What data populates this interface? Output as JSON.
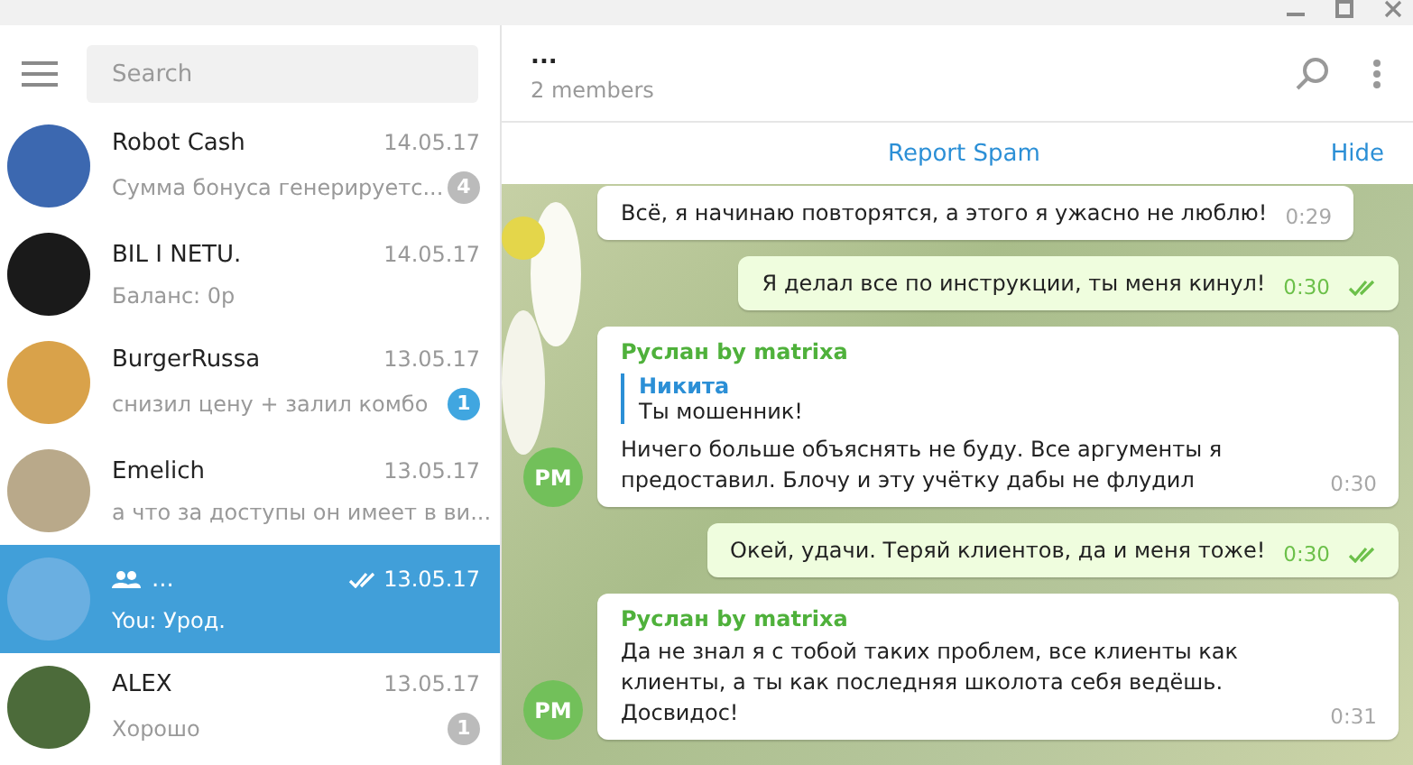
{
  "sidebar": {
    "search": {
      "placeholder": "Search"
    },
    "chats": [
      {
        "kind": "user",
        "name": "Robot Cash",
        "date": "14.05.17",
        "preview": "Сумма бонуса генерируетс...",
        "unread": "4",
        "muted": true,
        "selected": false,
        "read": false
      },
      {
        "kind": "user",
        "name": "BIL I NETU.",
        "date": "14.05.17",
        "preview": "Баланс: 0р",
        "selected": false,
        "read": false
      },
      {
        "kind": "user",
        "name": "BurgerRussa",
        "date": "13.05.17",
        "preview": "снизил цену + залил комбо",
        "unread": "1",
        "muted": false,
        "selected": false,
        "read": false
      },
      {
        "kind": "user",
        "name": "Emelich",
        "date": "13.05.17",
        "preview": "а что за доступы он имеет в ви...",
        "selected": false,
        "read": false
      },
      {
        "kind": "group",
        "name": "...",
        "date": "13.05.17",
        "preview": "You: Урод.",
        "selected": true,
        "read": true
      },
      {
        "kind": "user",
        "name": "ALEX",
        "date": "13.05.17",
        "preview": "Хорошо",
        "unread": "1",
        "muted": true,
        "selected": false,
        "read": false
      }
    ]
  },
  "chat": {
    "title": "...",
    "subtitle": "2 members",
    "report_spam": "Report Spam",
    "hide": "Hide",
    "messages": [
      {
        "kind": "in",
        "text": "Всё, я начинаю повторятся, а этого я ужасно не люблю!",
        "time": "0:29"
      },
      {
        "kind": "out",
        "text": "Я делал все по инструкции,  ты меня кинул!",
        "time": "0:30",
        "read": true
      },
      {
        "kind": "in",
        "author": "Руслан by matrixa",
        "reply": {
          "author": "Никита",
          "text": "Ты мошенник!"
        },
        "text": "Ничего больше объяснять не буду. Все аргументы я предоставил. Блочу и эту учётку дабы не флудил",
        "time": "0:30",
        "avatar": "PM"
      },
      {
        "kind": "out",
        "text": "Окей, удачи. Теряй клиентов, да и меня тоже!",
        "time": "0:30",
        "read": true
      },
      {
        "kind": "in",
        "author": "Руслан by matrixa",
        "text": "Да не знал я с тобой таких проблем, все клиенты как клиенты, а ты как последняя школота себя ведёшь. Досвидос!",
        "time": "0:31",
        "avatar": "PM"
      }
    ]
  }
}
